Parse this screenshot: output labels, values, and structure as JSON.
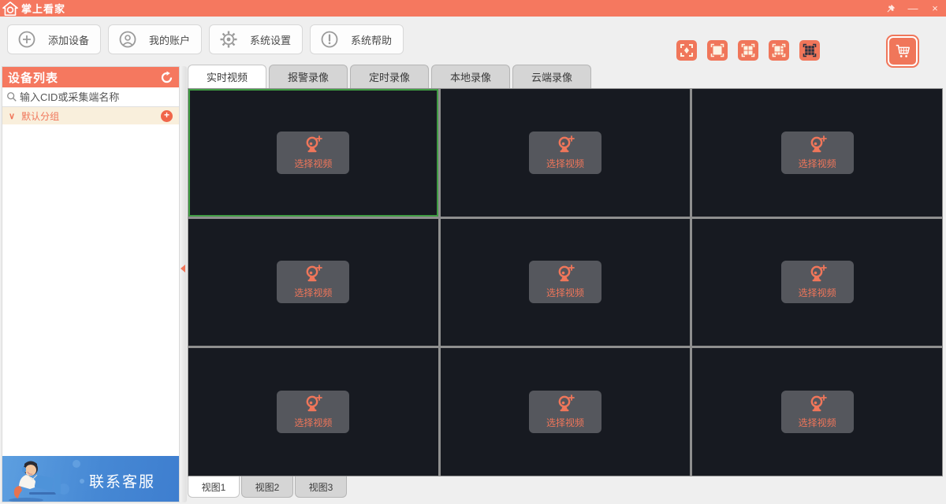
{
  "titlebar": {
    "title": "掌上看家",
    "pin_icon": "pin-icon",
    "minimize_label": "—",
    "close_label": "×"
  },
  "toolbar": {
    "buttons": [
      {
        "icon": "add-device-icon",
        "label": "添加设备"
      },
      {
        "icon": "account-icon",
        "label": "我的账户"
      },
      {
        "icon": "settings-gear-icon",
        "label": "系统设置"
      },
      {
        "icon": "help-icon",
        "label": "系统帮助"
      }
    ]
  },
  "layout_toolbar": {
    "buttons": [
      {
        "name": "fullscreen-layout"
      },
      {
        "name": "single-view-layout"
      },
      {
        "name": "quad-view-layout"
      },
      {
        "name": "mixed-view-layout"
      },
      {
        "name": "nine-view-layout",
        "active": true
      }
    ],
    "cart": {
      "name": "store-cart"
    }
  },
  "sidebar": {
    "header": "设备列表",
    "refresh_icon": "refresh-icon",
    "search_placeholder": "输入CID或采集端名称",
    "group": {
      "label": "默认分组",
      "chevron": "∨",
      "add_label": "+"
    },
    "contact_label": "联系客服"
  },
  "main": {
    "tabs": [
      {
        "label": "实时视频",
        "active": true
      },
      {
        "label": "报警录像",
        "active": false
      },
      {
        "label": "定时录像",
        "active": false
      },
      {
        "label": "本地录像",
        "active": false
      },
      {
        "label": "云端录像",
        "active": false
      }
    ],
    "grid": {
      "rows": 3,
      "cols": 3,
      "selected_cell": 1
    },
    "cell_button_label": "选择视频",
    "view_tabs": [
      {
        "label": "视图1",
        "active": true
      },
      {
        "label": "视图2",
        "active": false
      },
      {
        "label": "视图3",
        "active": false
      }
    ]
  },
  "colors": {
    "accent_orange": "#F5785F",
    "button_orange": "#F0765A",
    "selected_green": "#3F9C43",
    "cell_dark": "#171A21",
    "contact_blue": "#4688D4",
    "cream_group": "#F9EFDC",
    "page_bg": "#EFEFEF"
  }
}
